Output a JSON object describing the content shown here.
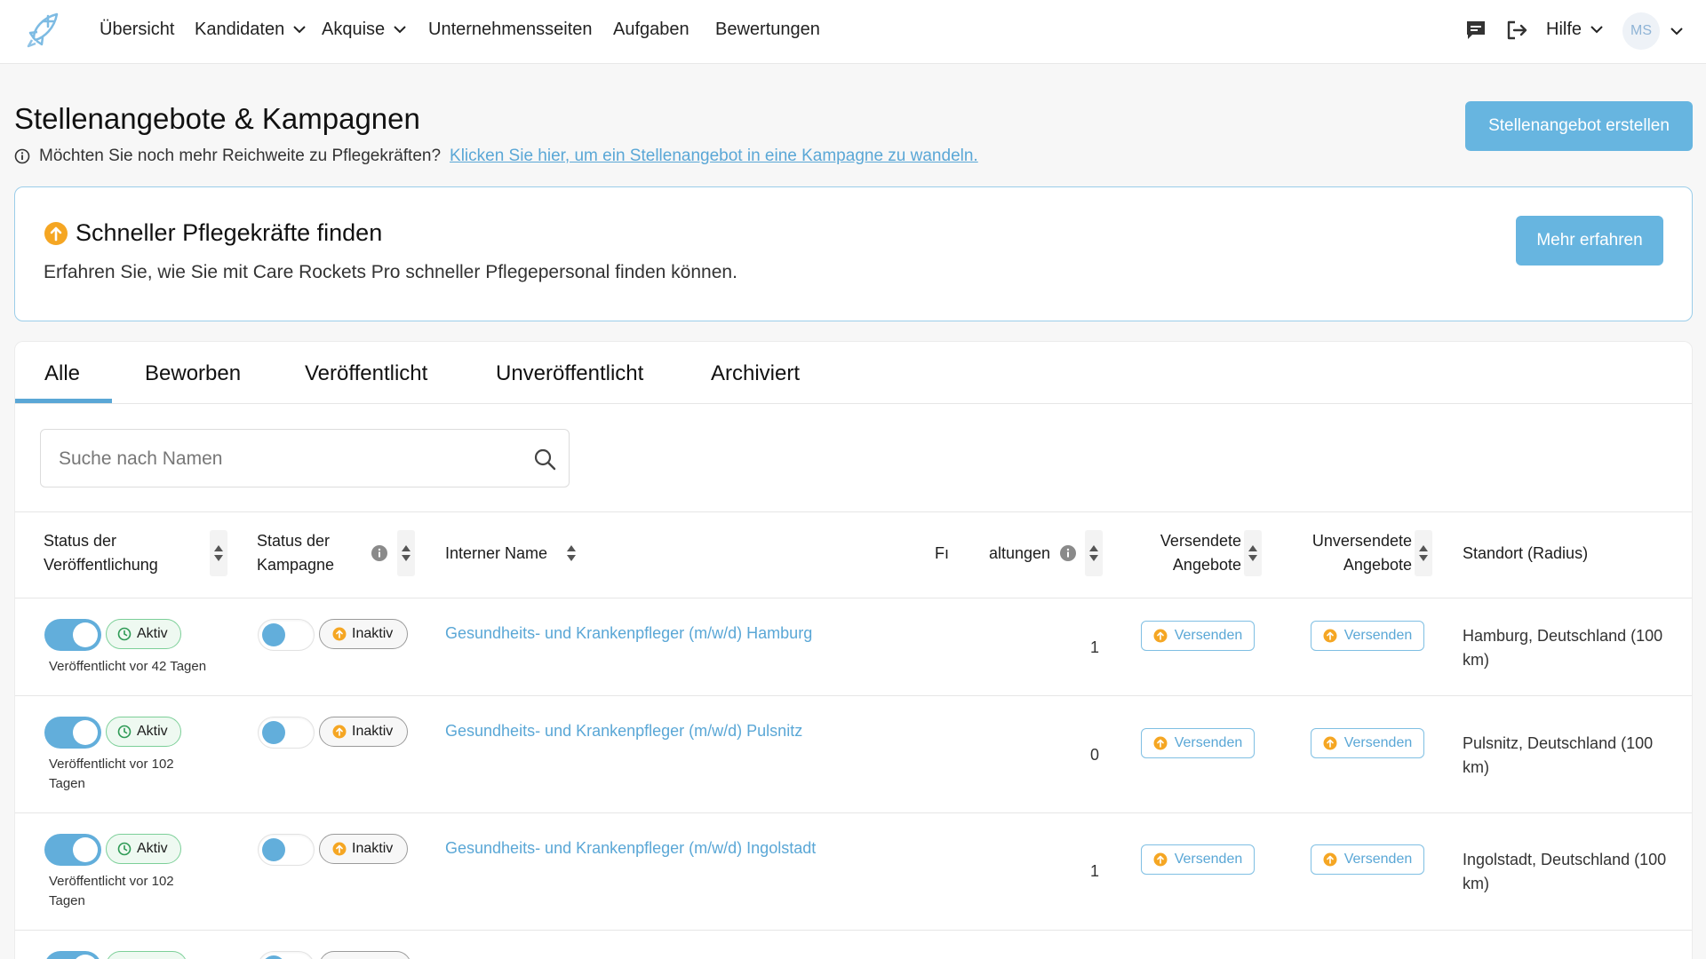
{
  "nav": {
    "items": [
      {
        "label": "Übersicht"
      },
      {
        "label": "Kandidaten"
      },
      {
        "label": "Akquise"
      },
      {
        "label": "Unternehmensseiten"
      },
      {
        "label": "Aufgaben"
      },
      {
        "label": "Bewertungen"
      }
    ],
    "help_label": "Hilfe",
    "avatar_initials": "MS"
  },
  "header": {
    "title": "Stellenangebote & Kampagnen",
    "info_text": "Möchten Sie noch mehr Reichweite zu Pflegekräften?",
    "info_link": "Klicken Sie hier, um ein Stellenangebot in eine Kampagne zu wandeln.",
    "create_button": "Stellenangebot erstellen"
  },
  "promo": {
    "title": "Schneller Pflegekräfte finden",
    "description": "Erfahren Sie, wie Sie mit Care Rockets Pro schneller Pflegepersonal finden können.",
    "button": "Mehr erfahren"
  },
  "tabs": [
    {
      "label": "Alle",
      "active": true
    },
    {
      "label": "Beworben"
    },
    {
      "label": "Veröffentlicht"
    },
    {
      "label": "Unveröffentlicht"
    },
    {
      "label": "Archiviert"
    }
  ],
  "search": {
    "placeholder": "Suche nach Namen"
  },
  "table": {
    "headers": {
      "status_publication": [
        "Status der",
        "Veröffentlichung"
      ],
      "status_campaign": [
        "Status der",
        "Kampagne"
      ],
      "internal_name": "Interner Name",
      "col_f": "Fı",
      "col_altungen": "altungen",
      "sent_offers": [
        "Versendete",
        "Angebote"
      ],
      "unsent_offers": [
        "Unversendete",
        "Angebote"
      ],
      "location": "Standort (Radius)"
    },
    "rows": [
      {
        "status_label": "Aktiv",
        "campaign_label": "Inaktiv",
        "published_text": "Veröffentlicht vor 42 Tagen",
        "name": "Gesundheits- und Krankenpfleger (m/w/d) Hamburg",
        "count": "1",
        "send_label": "Versenden",
        "send_label_2": "Versenden",
        "location": "Hamburg, Deutschland (100 km)"
      },
      {
        "status_label": "Aktiv",
        "campaign_label": "Inaktiv",
        "published_text": "Veröffentlicht vor 102 Tagen",
        "name": "Gesundheits- und Krankenpfleger (m/w/d) Pulsnitz",
        "count": "0",
        "send_label": "Versenden",
        "send_label_2": "Versenden",
        "location": "Pulsnitz, Deutschland (100 km)"
      },
      {
        "status_label": "Aktiv",
        "campaign_label": "Inaktiv",
        "published_text": "Veröffentlicht vor 102 Tagen",
        "name": "Gesundheits- und Krankenpfleger (m/w/d) Ingolstadt",
        "count": "1",
        "send_label": "Versenden",
        "send_label_2": "Versenden",
        "location": "Ingolstadt, Deutschland (100 km)"
      }
    ]
  },
  "colors": {
    "accent": "#62aedb",
    "success": "#7ccf98",
    "warning": "#f5a623"
  },
  "icons": {
    "logo": "rocket-logo-icon",
    "chat": "chat-icon",
    "logout": "logout-icon",
    "info": "info-icon",
    "search": "search-icon",
    "clock": "clock-icon",
    "upgrade": "arrow-up-circle-icon",
    "sort": "sort-icon"
  }
}
